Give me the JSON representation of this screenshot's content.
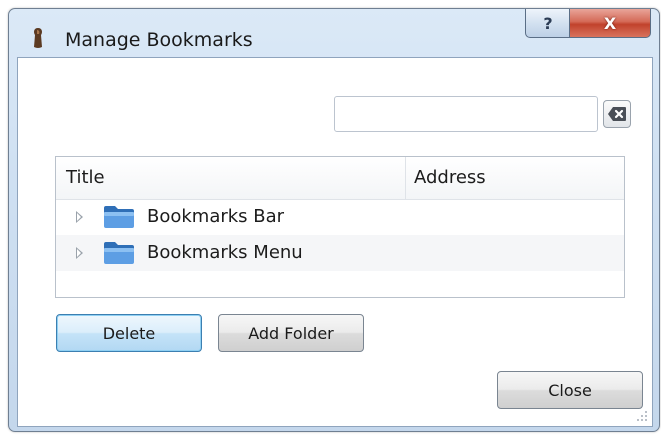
{
  "window": {
    "title": "Manage Bookmarks",
    "help_glyph": "?",
    "close_glyph": "X"
  },
  "search": {
    "value": "",
    "placeholder": ""
  },
  "tree": {
    "columns": [
      "Title",
      "Address"
    ],
    "rows": [
      {
        "title": "Bookmarks Bar",
        "address": "",
        "icon": "folder-icon"
      },
      {
        "title": "Bookmarks Menu",
        "address": "",
        "icon": "folder-icon"
      }
    ]
  },
  "buttons": {
    "delete_label": "Delete",
    "add_folder_label": "Add Folder",
    "close_label": "Close"
  },
  "colors": {
    "title_bar": "#cfe0f2",
    "close_button": "#c1422c",
    "default_button_border": "#3c7fb1",
    "folder": "#4f8fd6"
  }
}
